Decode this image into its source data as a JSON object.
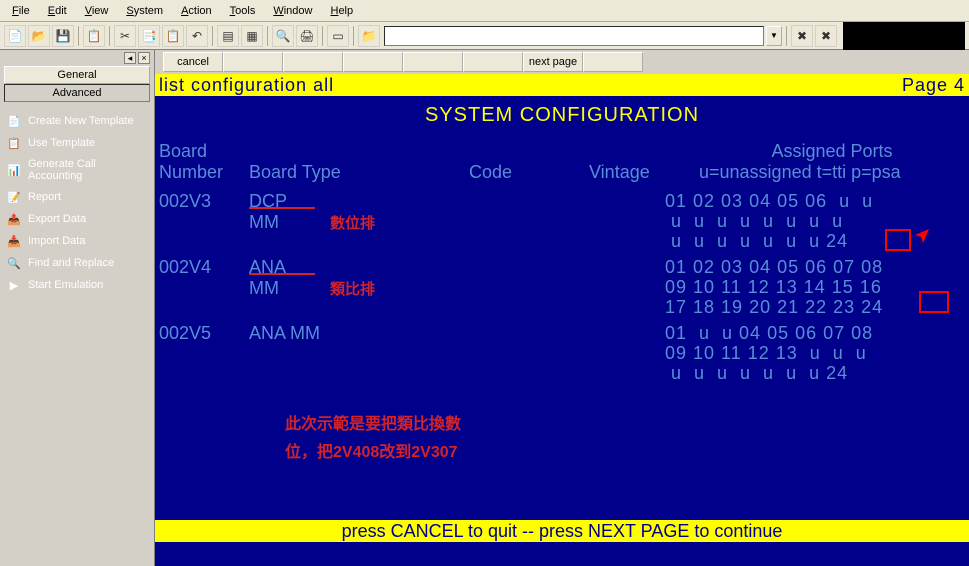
{
  "menubar": [
    "File",
    "Edit",
    "View",
    "System",
    "Action",
    "Tools",
    "Window",
    "Help"
  ],
  "sidebar": {
    "tabs": [
      "General",
      "Advanced"
    ],
    "items": [
      {
        "icon": "📄",
        "label": "Create New Template"
      },
      {
        "icon": "📋",
        "label": "Use Template"
      },
      {
        "icon": "📊",
        "label": "Generate Call Accounting"
      },
      {
        "icon": "📝",
        "label": "Report"
      },
      {
        "icon": "📤",
        "label": "Export Data"
      },
      {
        "icon": "📥",
        "label": "Import Data"
      },
      {
        "icon": "🔍",
        "label": "Find and Replace"
      },
      {
        "icon": "▶",
        "label": "Start Emulation"
      }
    ]
  },
  "button_row": {
    "cancel": "cancel",
    "next": "next page"
  },
  "terminal": {
    "cmd_line_left": "list configuration all",
    "cmd_line_right": "Page   4",
    "title": "SYSTEM CONFIGURATION",
    "headers": {
      "board_l1": "Board",
      "board_l2": "Number",
      "type": "Board Type",
      "code": "Code",
      "vintage": "Vintage",
      "ports_l1": "Assigned Ports",
      "ports_l2": "u=unassigned t=tti p=psa"
    },
    "rows": [
      {
        "board": "002V3",
        "type": "DCP MM",
        "anno": "數位排",
        "ports": "01 02 03 04 05 06  u  u\n u  u  u  u  u  u  u  u\n u  u  u  u  u  u  u 24"
      },
      {
        "board": "002V4",
        "type": "ANA MM",
        "anno": "類比排",
        "ports": "01 02 03 04 05 06 07 08\n09 10 11 12 13 14 15 16\n17 18 19 20 21 22 23 24"
      },
      {
        "board": "002V5",
        "type": "ANA MM",
        "anno": "",
        "ports": "01  u  u 04 05 06 07 08\n09 10 11 12 13  u  u  u\n u  u  u  u  u  u  u 24"
      }
    ],
    "note_l1": "此次示範是要把類比換數",
    "note_l2": "位，把2V408改到2V307",
    "footer": "press CANCEL to quit --  press NEXT PAGE to continue"
  }
}
